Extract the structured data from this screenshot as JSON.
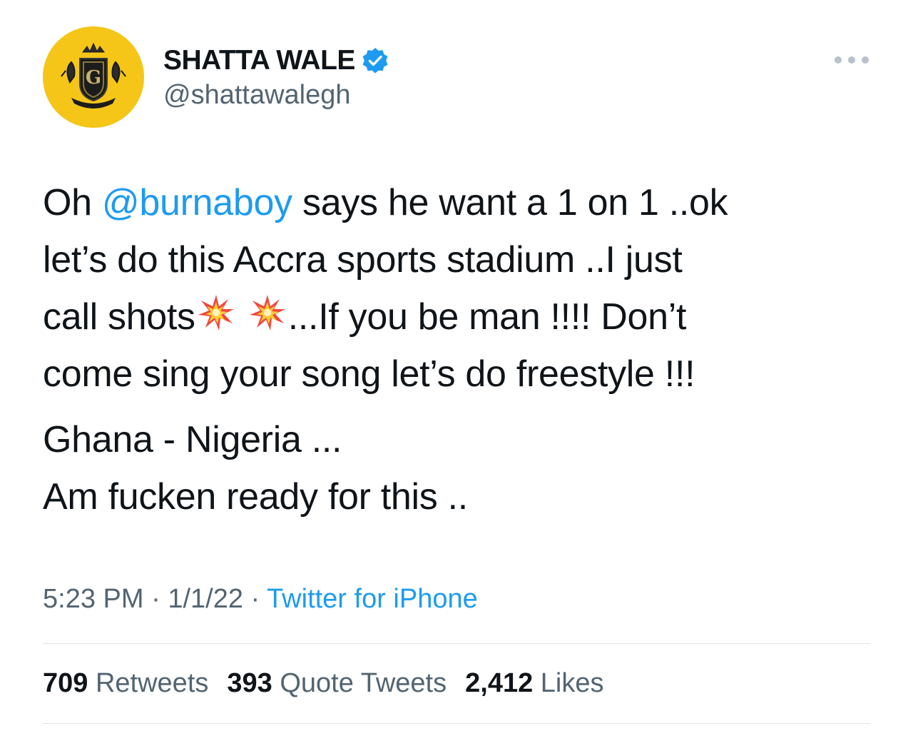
{
  "author": {
    "display_name": "SHATTA WALE",
    "handle": "@shattawalegh",
    "avatar_icon": "crest-logo",
    "avatar_bg": "#f5c518",
    "verified_icon": "verified-badge-icon",
    "verified_color": "#1d9bf0"
  },
  "menu_icon": "more-options-icon",
  "tweet": {
    "lines": [
      {
        "t1": "Oh ",
        "mention": "@burnaboy",
        "t2": " says he want a 1 on 1 ..ok"
      },
      {
        "text": "let’s do this Accra sports stadium ..I just"
      },
      {
        "pre": "call shots",
        "emoji": "collision-emoji",
        "post": "...If you be man !!!! Don’t"
      },
      {
        "text": "come sing your song let’s do freestyle !!!"
      },
      {
        "text": "Ghana - Nigeria ..."
      },
      {
        "text": "Am fucken ready for this .."
      }
    ]
  },
  "meta": {
    "time": "5:23 PM",
    "separator": " · ",
    "date": "1/1/22",
    "source": "Twitter for iPhone"
  },
  "stats": {
    "retweets_count": "709",
    "retweets_label": "Retweets",
    "quotes_count": "393",
    "quotes_label": "Quote Tweets",
    "likes_count": "2,412",
    "likes_label": "Likes"
  },
  "colors": {
    "text": "#0f1419",
    "secondary": "#536471",
    "link": "#1d9bf0",
    "divider": "#e1e6ea"
  }
}
